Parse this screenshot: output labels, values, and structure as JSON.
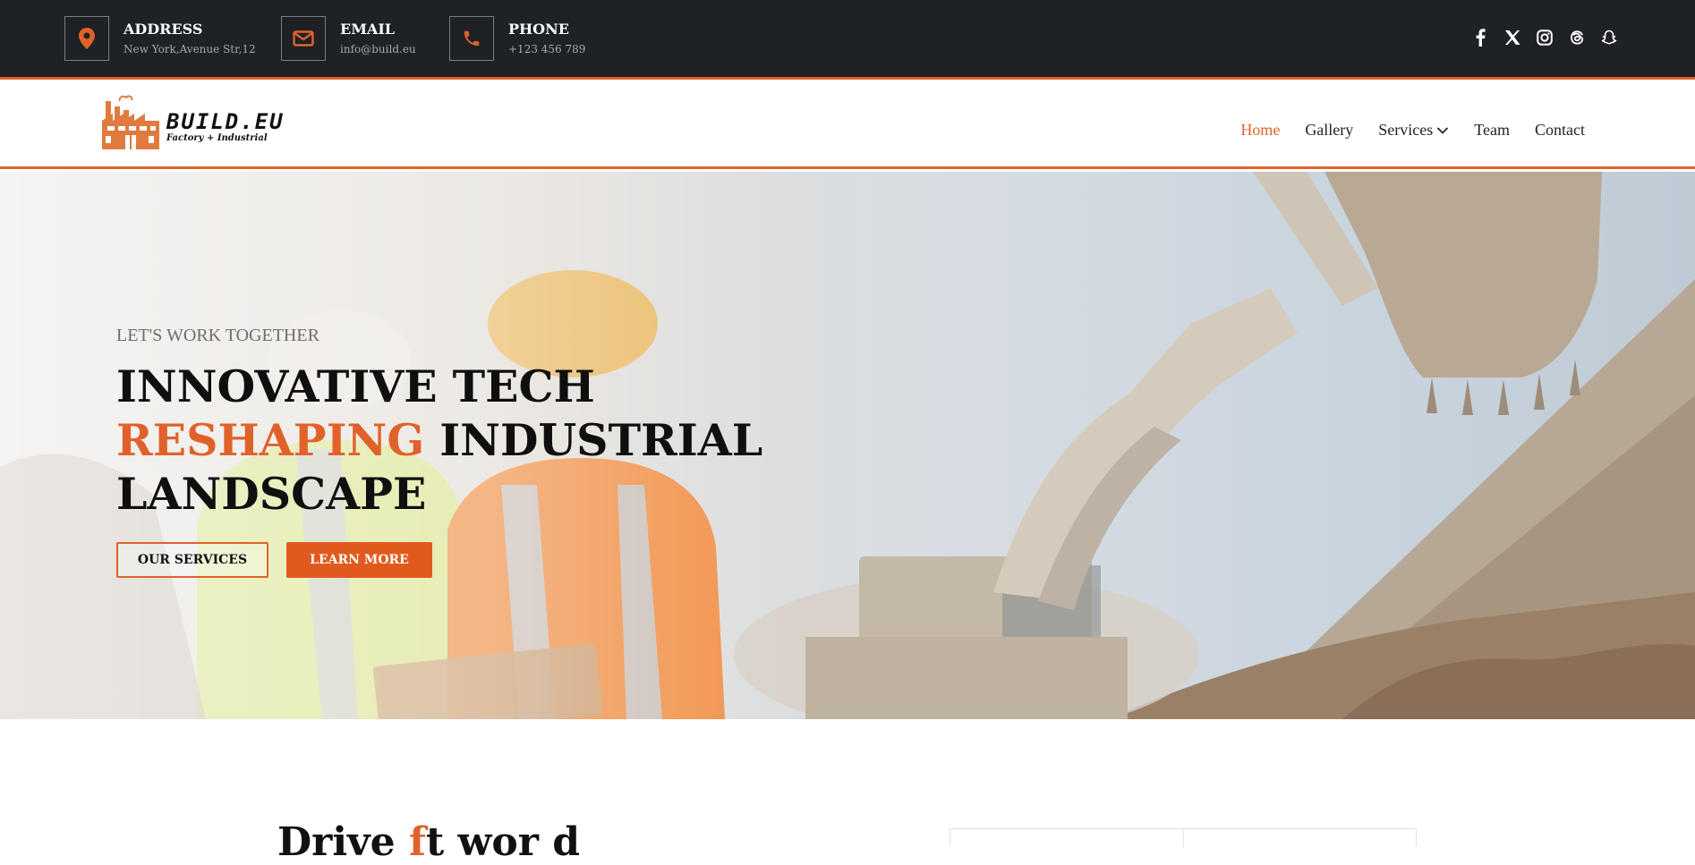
{
  "topbar": {
    "address": {
      "label": "ADDRESS",
      "value": "New York,Avenue Str,12",
      "icon": "map-pin-icon"
    },
    "email": {
      "label": "EMAIL",
      "value": "info@build.eu",
      "icon": "envelope-icon"
    },
    "phone": {
      "label": "PHONE",
      "value": "+123 456 789",
      "icon": "phone-icon"
    },
    "social": [
      "facebook-icon",
      "x-icon",
      "instagram-icon",
      "threads-icon",
      "snapchat-icon"
    ]
  },
  "brand": {
    "name": "BUILD.EU",
    "tagline": "Factory + Industrial"
  },
  "nav": {
    "items": [
      "Home",
      "Gallery",
      "Services",
      "Team",
      "Contact"
    ],
    "active": "Home"
  },
  "hero": {
    "kicker": "LET'S WORK TOGETHER",
    "line1": "INNOVATIVE TECH",
    "line2_accent": "RESHAPING",
    "line2_rest": "INDUSTRIAL",
    "line3": "LANDSCAPE",
    "btn_services": "OUR SERVICES",
    "btn_learn": "LEARN MORE"
  },
  "below": {
    "title_start": "Drive",
    "title_accent": "f",
    "title_end": "t wor d"
  },
  "colors": {
    "accent": "#e0622a",
    "topbar_bg": "#1e2125",
    "button_fill": "#e05a1e"
  }
}
